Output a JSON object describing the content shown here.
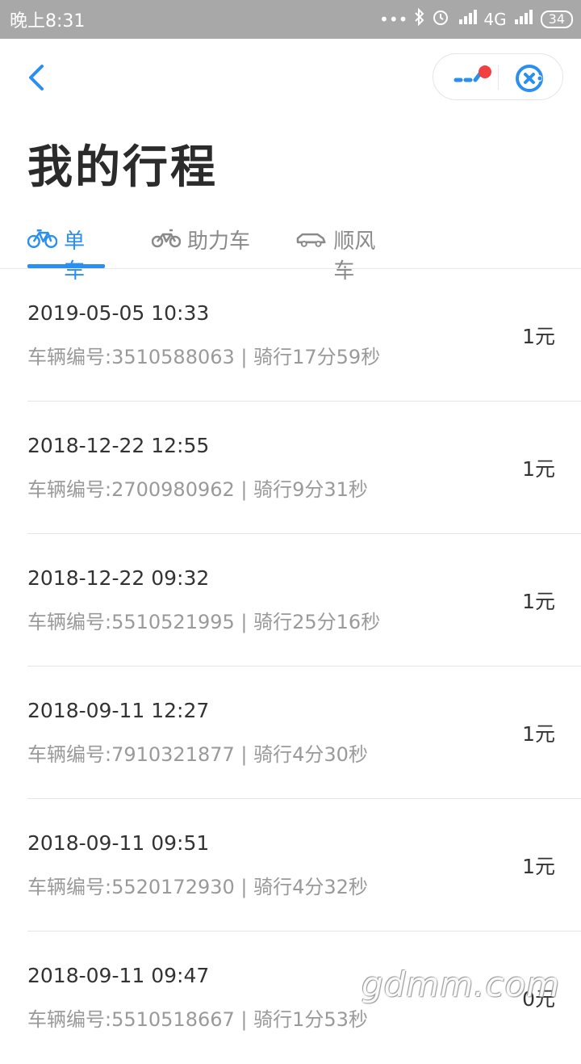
{
  "status_bar": {
    "time": "晚上8:31",
    "network": "4G",
    "battery": "34",
    "icons": [
      "more-dots-icon",
      "bluetooth-icon",
      "alarm-icon",
      "hd-signal-icon",
      "signal-icon"
    ]
  },
  "header": {
    "back_icon": "chevron-left-icon",
    "capsule": {
      "more_icon": "more-icon",
      "close_icon": "close-icon"
    },
    "accent": "#2a8ff0",
    "badge_color": "#f24040"
  },
  "page": {
    "title": "我的行程"
  },
  "tabs": [
    {
      "label": "单车",
      "icon": "bicycle-icon",
      "active": true
    },
    {
      "label": "助力车",
      "icon": "ebike-icon",
      "active": false
    },
    {
      "label": "顺风车",
      "icon": "car-icon",
      "active": false
    }
  ],
  "trips": [
    {
      "time": "2019-05-05 10:33",
      "detail": "车辆编号:3510588063 | 骑行17分59秒",
      "price": "1元"
    },
    {
      "time": "2018-12-22 12:55",
      "detail": "车辆编号:2700980962 | 骑行9分31秒",
      "price": "1元"
    },
    {
      "time": "2018-12-22 09:32",
      "detail": "车辆编号:5510521995 | 骑行25分16秒",
      "price": "1元"
    },
    {
      "time": "2018-09-11 12:27",
      "detail": "车辆编号:7910321877 | 骑行4分30秒",
      "price": "1元"
    },
    {
      "time": "2018-09-11 09:51",
      "detail": "车辆编号:5520172930 | 骑行4分32秒",
      "price": "1元"
    },
    {
      "time": "2018-09-11 09:47",
      "detail": "车辆编号:5510518667 | 骑行1分53秒",
      "price": "0元"
    }
  ],
  "watermark": "gdmm.com"
}
